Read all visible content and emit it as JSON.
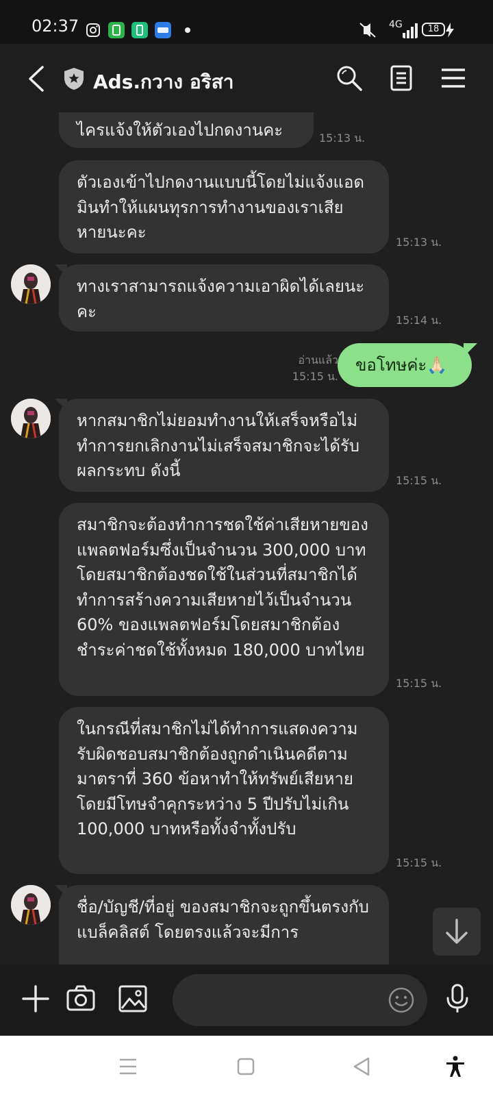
{
  "status_bar": {
    "time": "02:37",
    "network": "4G",
    "battery": "18",
    "icons": [
      "instagram-icon",
      "app-icon-green",
      "battery-saver-icon",
      "noveltoon-icon",
      "mute-icon",
      "signal-icon",
      "charging-icon"
    ]
  },
  "header": {
    "title": "Ads.กวาง อริสา",
    "icons": [
      "back-icon",
      "shield-icon",
      "search-icon",
      "notes-icon",
      "menu-icon"
    ]
  },
  "messages": [
    {
      "text": "ไครแจ้งให้ตัวเองไปกดงานคะ",
      "time": "15:13 น."
    },
    {
      "text": "ตัวเองเข้าไปกดงานแบบนี้โดยไม่แจ้งแอดมินทำให้แผนทุรการทำงานของเราเสียหายนะคะ",
      "time": "15:13 น."
    },
    {
      "text": "ทางเราสามารถแจ้งความเอาผิดได้เลยนะคะ",
      "time": "15:14 น."
    },
    {
      "text": "ขอโทษค่ะ🙏🏻",
      "time": "15:15 น.",
      "read_label": "อ่านแล้ว"
    },
    {
      "text": "หากสมาชิกไม่ยอมทำงานให้เสร็จหรือไม่ทำการยกเลิกงานไม่เสร็จสมาชิกจะได้รับผลกระทบ ดังนี้",
      "time": "15:15 น."
    },
    {
      "text": "สมาชิกจะต้องทำการชดใช้ค่าเสียหายของแพลตฟอร์มซึ่งเป็นจำนวน 300,000 บาทโดยสมาชิกต้องชดใช้ในส่วนที่สมาชิกได้ทำการสร้างความเสียหายไว้เป็นจำนวน 60% ของแพลตฟอร์มโดยสมาชิกต้องชำระค่าชดใช้ทั้งหมด 180,000 บาทไทย",
      "time": "15:15 น."
    },
    {
      "text": "ในกรณีที่สมาชิกไม่ได้ทำการแสดงความรับผิดชอบสมาชิกต้องถูกดำเนินคดีตามมาตราที่ 360 ข้อหาทำให้ทรัพย์เสียหายโดยมีโทษจำคุกระหว่าง 5 ปีปรับไม่เกิน 100,000 บาทหรือทั้งจำทั้งปรับ",
      "time": "15:15 น."
    },
    {
      "text": "ชื่อ/บัญชี/ที่อยู่ ของสมาชิกจะถูกขึ้นตรงกับแบล็คลิสต์ โดยตรงแล้วจะมีการ"
    }
  ],
  "input": {
    "placeholder": "",
    "icons": [
      "plus-icon",
      "camera-icon",
      "image-icon",
      "emoji-icon",
      "microphone-icon"
    ]
  },
  "nav": {
    "icons": [
      "recent-apps-icon",
      "home-icon",
      "back-nav-icon",
      "accessibility-icon"
    ]
  },
  "colors": {
    "background": "#1f1f1f",
    "bubble_incoming": "#333333",
    "bubble_outgoing": "#8ce08a"
  }
}
